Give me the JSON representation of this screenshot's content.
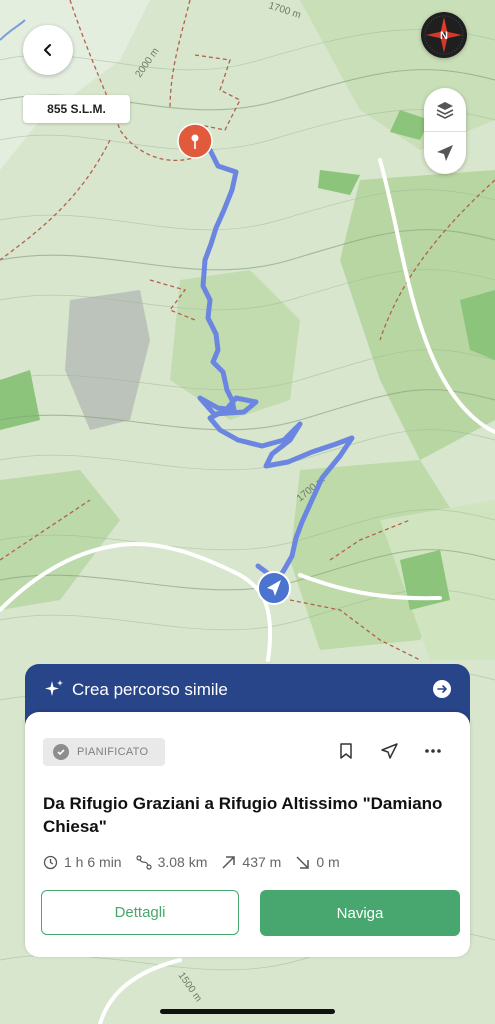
{
  "map": {
    "altitude_badge": "855 S.L.M.",
    "contour_labels": [
      "1700 m",
      "2000 m",
      "1700 m",
      "1500 m"
    ]
  },
  "colors": {
    "route": "#6b86e0",
    "promo_bg": "#294589",
    "accent_green": "#47a76e",
    "destination_pin": "#e15a3c"
  },
  "icons": {
    "back": "chevron-left-icon",
    "compass": "compass-icon",
    "layers": "layers-icon",
    "locate": "location-arrow-icon",
    "promo": "sparkle-icon",
    "promo_go": "arrow-right-circle-icon",
    "bookmark": "bookmark-icon",
    "share": "send-icon",
    "more": "more-dots-icon"
  },
  "compass": {
    "label": "N"
  },
  "promo": {
    "label": "Crea percorso simile"
  },
  "card": {
    "status": "PIANIFICATO",
    "title": "Da Rifugio Graziani a Rifugio Altissimo \"Damiano Chiesa\"",
    "stats": {
      "duration": "1 h 6 min",
      "distance": "3.08 km",
      "ascent": "437 m",
      "descent": "0 m"
    },
    "details_button": "Dettagli",
    "navigate_button": "Naviga"
  }
}
